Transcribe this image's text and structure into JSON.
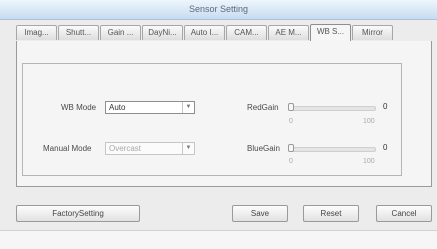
{
  "window": {
    "title": "Sensor Setting"
  },
  "tabs": [
    {
      "label": "Imag..."
    },
    {
      "label": "Shutt..."
    },
    {
      "label": "Gain ..."
    },
    {
      "label": "DayNi..."
    },
    {
      "label": "Auto I..."
    },
    {
      "label": "CAM..."
    },
    {
      "label": "AE M..."
    },
    {
      "label": "WB S..."
    },
    {
      "label": "Mirror"
    }
  ],
  "active_tab": "WB S...",
  "wb": {
    "wb_mode_label": "WB Mode",
    "wb_mode_value": "Auto",
    "manual_mode_label": "Manual Mode",
    "manual_mode_value": "Overcast"
  },
  "sliders": {
    "red_gain": {
      "label": "RedGain",
      "value": "0",
      "min": "0",
      "max": "100"
    },
    "blue_gain": {
      "label": "BlueGain",
      "value": "0",
      "min": "0",
      "max": "100"
    }
  },
  "buttons": {
    "factory": "FactorySetting",
    "save": "Save",
    "reset": "Reset",
    "cancel": "Cancel"
  }
}
